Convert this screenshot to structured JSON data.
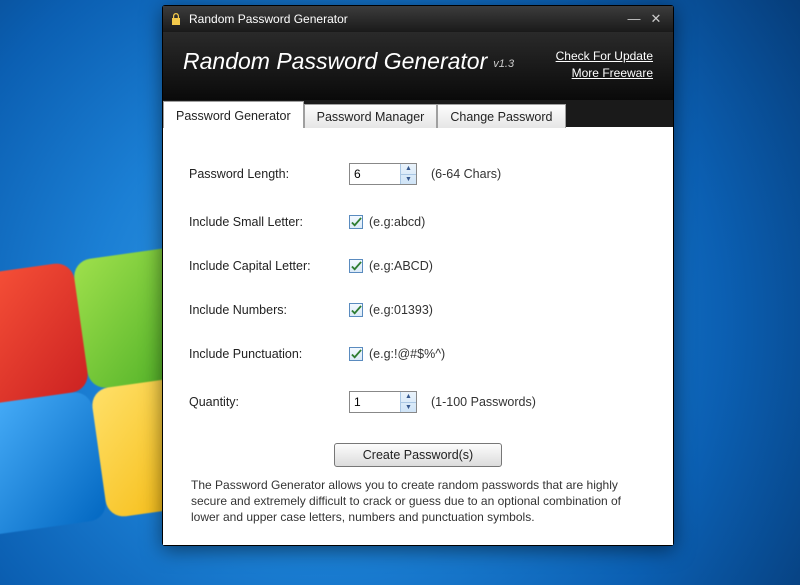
{
  "window": {
    "title": "Random Password Generator"
  },
  "header": {
    "title": "Random Password Generator",
    "version": "v1.3",
    "link_update": "Check For Update",
    "link_freeware": "More Freeware"
  },
  "tabs": {
    "generator": "Password Generator",
    "manager": "Password Manager",
    "change": "Change Password"
  },
  "form": {
    "length_label": "Password Length:",
    "length_value": "6",
    "length_hint": "(6-64 Chars)",
    "small_label": "Include Small Letter:",
    "small_eg": "(e.g:abcd)",
    "capital_label": "Include Capital Letter:",
    "capital_eg": "(e.g:ABCD)",
    "numbers_label": "Include Numbers:",
    "numbers_eg": "(e.g:01393)",
    "punct_label": "Include Punctuation:",
    "punct_eg": "(e.g:!@#$%^)",
    "qty_label": "Quantity:",
    "qty_value": "1",
    "qty_hint": "(1-100 Passwords)",
    "create_btn": "Create Password(s)",
    "description": "The Password Generator allows you to create random passwords that are highly secure and extremely difficult to crack or guess due to an optional combination of lower and upper case letters, numbers and punctuation symbols."
  }
}
